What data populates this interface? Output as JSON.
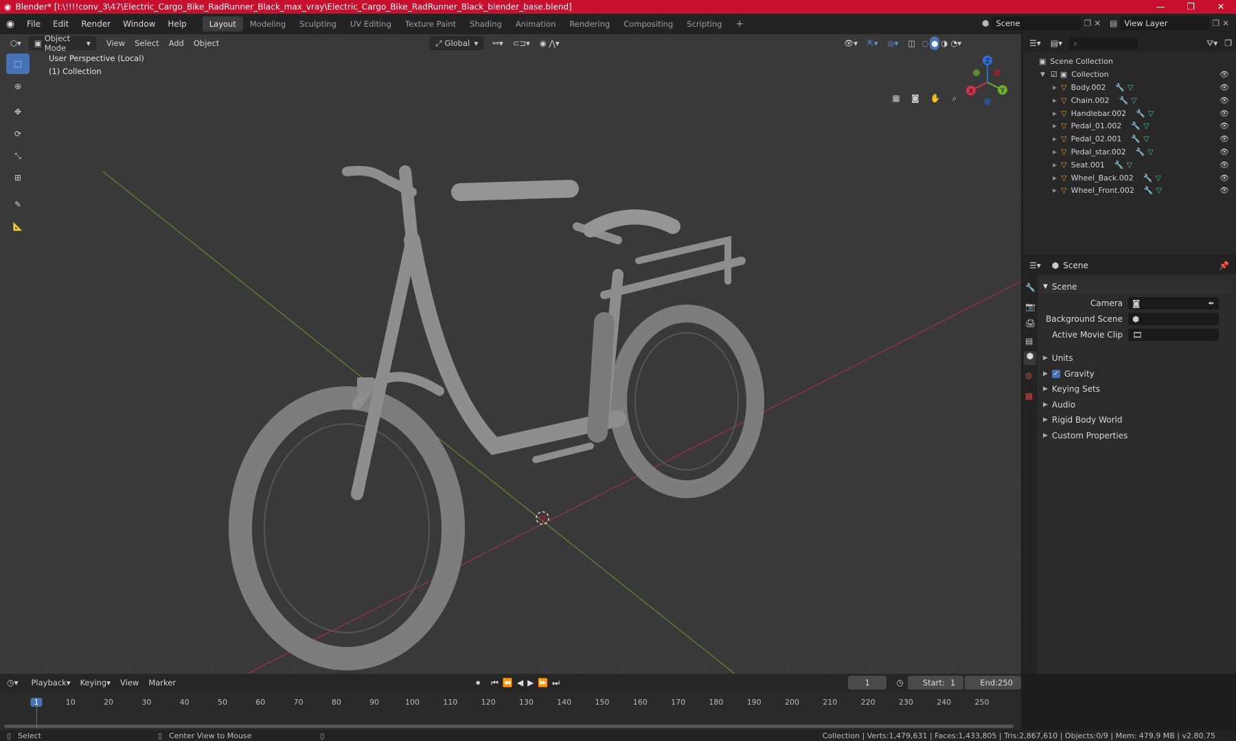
{
  "window": {
    "title": "Blender* [I:\\!!!!conv_3\\47\\Electric_Cargo_Bike_RadRunner_Black_max_vray\\Electric_Cargo_Bike_RadRunner_Black_blender_base.blend]",
    "controls": [
      "—",
      "❐",
      "✕"
    ]
  },
  "menubar": {
    "menus": [
      "File",
      "Edit",
      "Render",
      "Window",
      "Help"
    ],
    "workspaces": [
      "Layout",
      "Modeling",
      "Sculpting",
      "UV Editing",
      "Texture Paint",
      "Shading",
      "Animation",
      "Rendering",
      "Compositing",
      "Scripting"
    ],
    "active_workspace": "Layout",
    "add_workspace": "+",
    "scene_label": "Scene",
    "view_layer_label": "View Layer"
  },
  "viewport_header": {
    "mode": "Object Mode",
    "menus": [
      "View",
      "Select",
      "Add",
      "Object"
    ],
    "transform_orientation": "Global"
  },
  "viewport": {
    "perspective_label": "User Perspective (Local)",
    "collection_label": "(1) Collection",
    "gizmo_axes": {
      "x": "X",
      "y": "Y",
      "z": "Z"
    },
    "colors": {
      "background": "#393939",
      "x_axis": "#b23a48",
      "y_axis": "#7a9a2f",
      "model": "#8f8f8f"
    }
  },
  "tools": [
    "select-box-icon",
    "cursor-icon",
    "move-icon",
    "rotate-icon",
    "scale-icon",
    "transform-icon",
    "annotate-icon",
    "measure-icon"
  ],
  "outliner": {
    "search_placeholder": "",
    "root": "Scene Collection",
    "collection": "Collection",
    "objects": [
      "Body.002",
      "Chain.002",
      "Handlebar.002",
      "Pedal_01.002",
      "Pedal_02.001",
      "Pedal_star.002",
      "Seat.001",
      "Wheel_Back.002",
      "Wheel_Front.002"
    ]
  },
  "properties": {
    "context_title": "Scene",
    "panel_title": "Scene",
    "fields": [
      {
        "label": "Camera",
        "value": ""
      },
      {
        "label": "Background Scene",
        "value": ""
      },
      {
        "label": "Active Movie Clip",
        "value": ""
      }
    ],
    "subpanels": [
      "Units",
      "Gravity",
      "Keying Sets",
      "Audio",
      "Rigid Body World",
      "Custom Properties"
    ],
    "gravity_enabled": true
  },
  "timeline": {
    "menus": [
      "Playback",
      "Keying",
      "View",
      "Marker"
    ],
    "current_frame": "1",
    "start_label": "Start:",
    "start": "1",
    "end_label": "End:",
    "end": "250",
    "ticks": [
      "1",
      "10",
      "20",
      "30",
      "40",
      "50",
      "60",
      "70",
      "80",
      "90",
      "100",
      "110",
      "120",
      "130",
      "140",
      "150",
      "160",
      "170",
      "180",
      "190",
      "200",
      "210",
      "220",
      "230",
      "240",
      "250"
    ]
  },
  "statusbar": {
    "left_action": "Select",
    "mid_action": "Center View to Mouse",
    "stats": "Collection | Verts:1,479,631 | Faces:1,433,805 | Tris:2,867,610 | Objects:0/9 | Mem: 479.9 MB | v2.80.75"
  }
}
